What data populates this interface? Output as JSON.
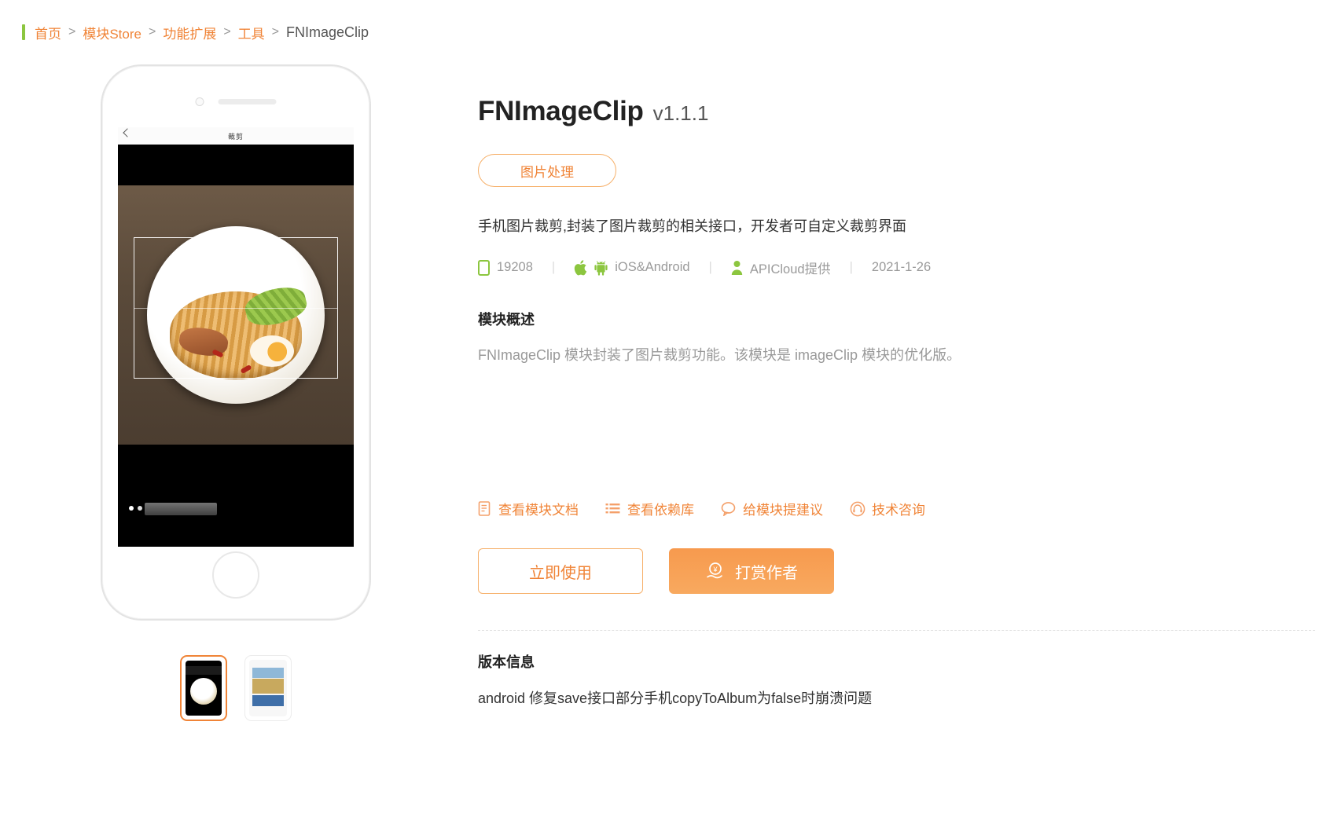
{
  "breadcrumb": {
    "items": [
      "首页",
      "模块Store",
      "功能扩展",
      "工具",
      "FNImageClip"
    ],
    "separator": ">"
  },
  "module": {
    "title": "FNImageClip",
    "version": "v1.1.1",
    "tag": "图片处理",
    "description": "手机图片裁剪,封装了图片裁剪的相关接口，开发者可自定义裁剪界面",
    "meta": {
      "downloads": "19208",
      "platform": "iOS&Android",
      "provider": "APICloud提供",
      "date": "2021-1-26",
      "separator": "|"
    },
    "overview": {
      "heading": "模块概述",
      "body": "FNImageClip 模块封装了图片裁剪功能。该模块是 imageClip 模块的优化版。"
    },
    "links": [
      {
        "label": "查看模块文档",
        "icon": "document-icon"
      },
      {
        "label": "查看依赖库",
        "icon": "list-icon"
      },
      {
        "label": "给模块提建议",
        "icon": "comment-icon"
      },
      {
        "label": "技术咨询",
        "icon": "headset-icon"
      }
    ],
    "buttons": {
      "use_now": "立即使用",
      "donate": "打赏作者"
    },
    "version_info": {
      "heading": "版本信息",
      "body": "android 修复save接口部分手机copyToAlbum为false时崩溃问题"
    }
  },
  "preview": {
    "phone_nav_title": "裁剪",
    "thumbnails": [
      {
        "name": "screenshot-1",
        "selected": true
      },
      {
        "name": "screenshot-2",
        "selected": false
      }
    ]
  },
  "colors": {
    "accent": "#f08437",
    "accent_light": "#f6b06a",
    "green": "#8cc63f",
    "meta_text": "#9a9a9a"
  }
}
